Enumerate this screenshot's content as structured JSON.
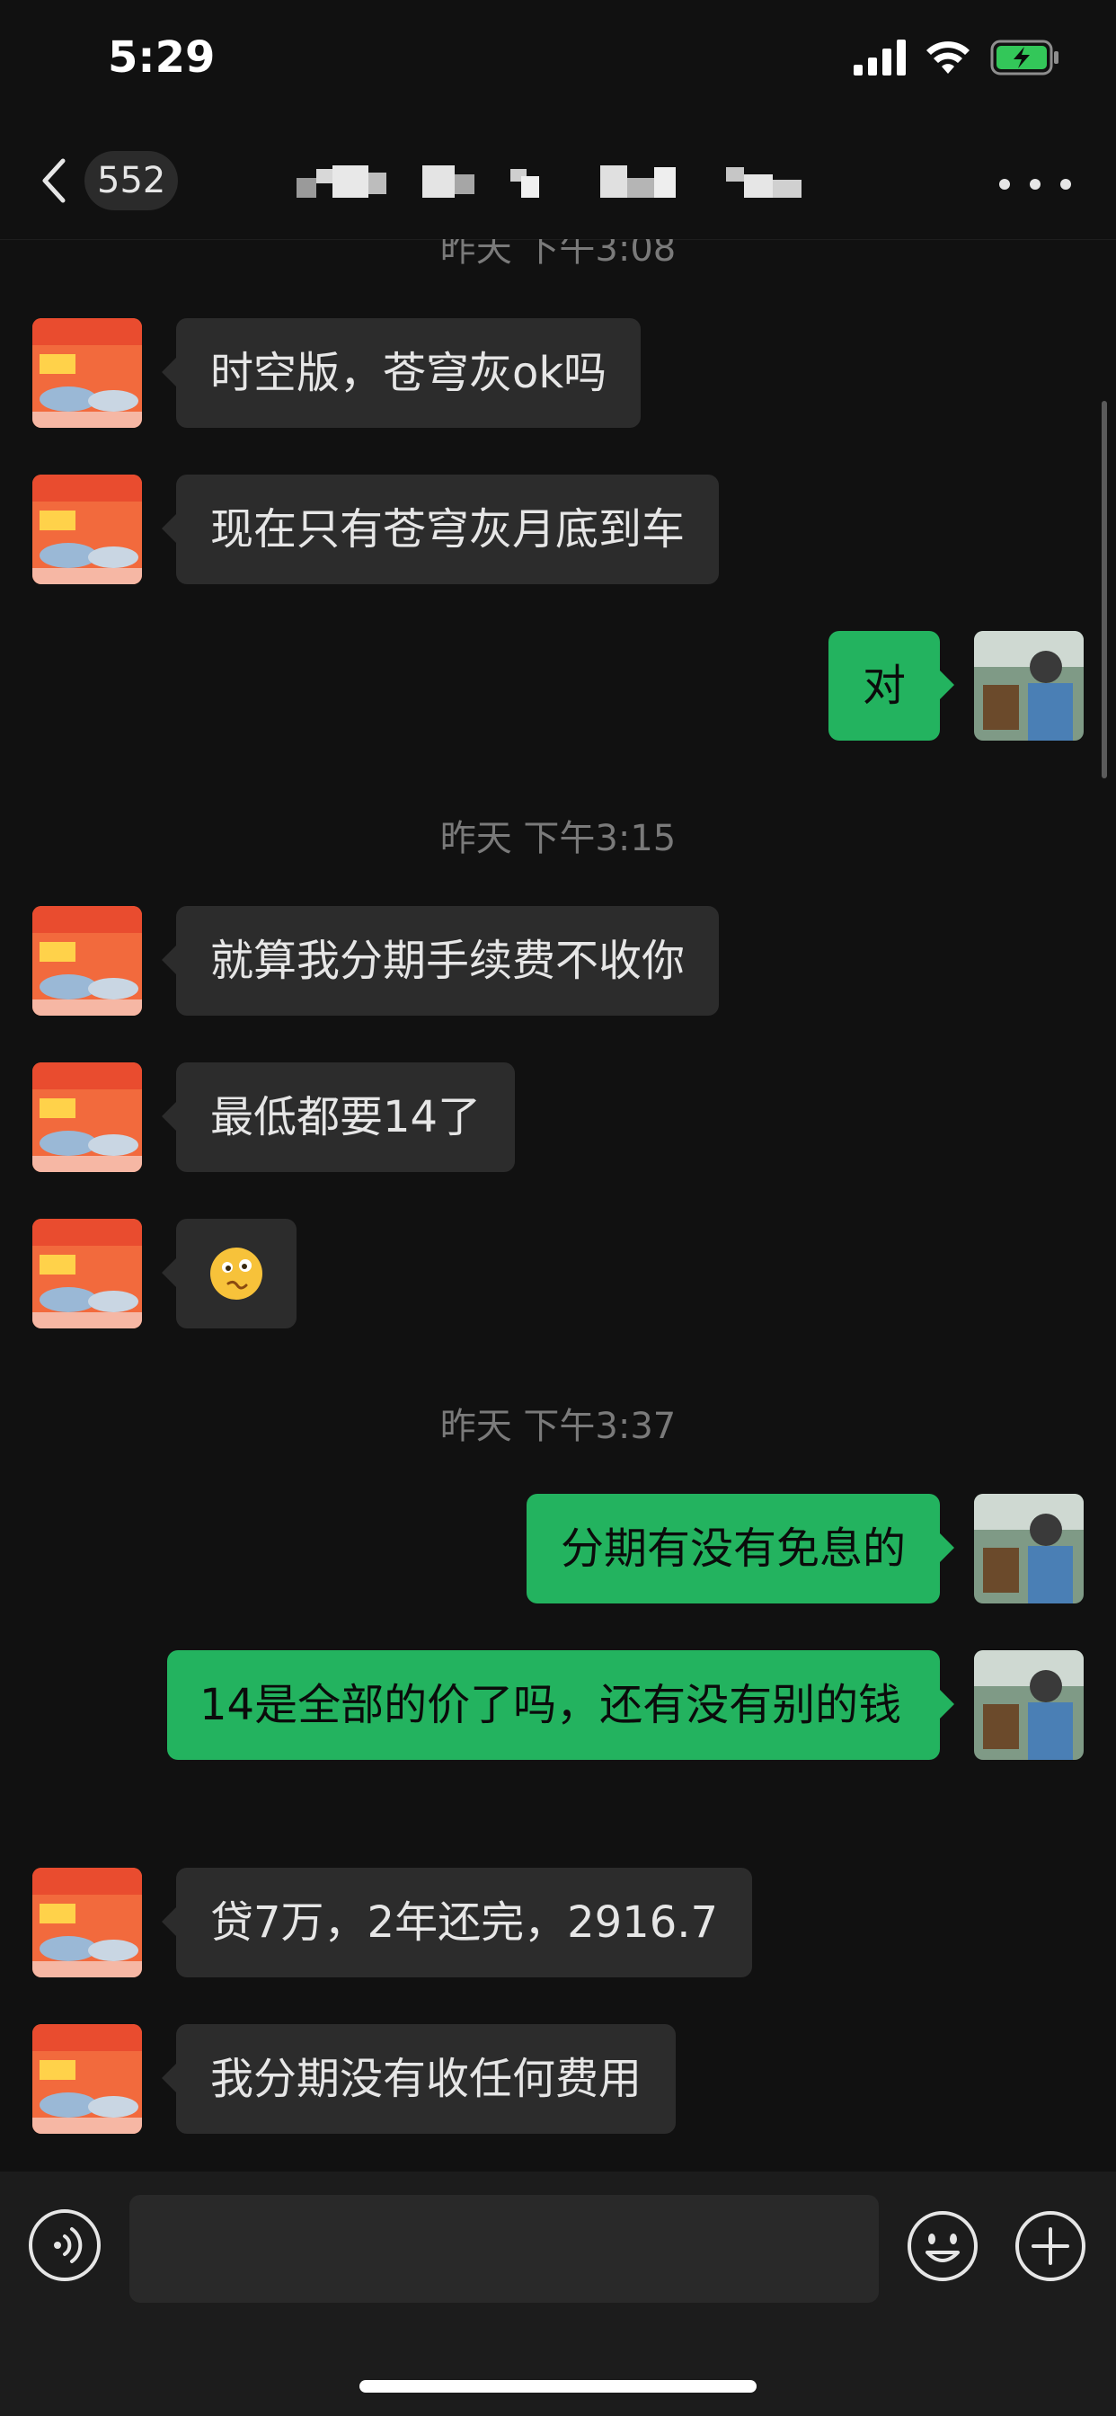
{
  "status_bar": {
    "time": "5:29",
    "icons": [
      "cellular-signal-icon",
      "wifi-icon",
      "battery-charging-icon"
    ],
    "battery_color": "#33c759"
  },
  "navbar": {
    "unread_count": "552",
    "title_obscured": true,
    "icons": [
      "back-arrow-icon",
      "more-options-icon"
    ]
  },
  "chat": {
    "timestamps": [
      "昨天 下午3:08",
      "昨天 下午3:15",
      "昨天 下午3:37"
    ],
    "messages": [
      {
        "side": "in",
        "text": "时空版，苍穹灰ok吗"
      },
      {
        "side": "in",
        "text": "现在只有苍穹灰月底到车"
      },
      {
        "side": "out",
        "text": "对"
      },
      {
        "side": "in",
        "text": "就算我分期手续费不收你"
      },
      {
        "side": "in",
        "text": "最低都要14了"
      },
      {
        "side": "in",
        "type": "emoji",
        "emoji": "woozy-face-emoji"
      },
      {
        "side": "out",
        "text": "分期有没有免息的"
      },
      {
        "side": "out",
        "text": "14是全部的价了吗，还有没有别的钱"
      },
      {
        "side": "in",
        "text": "贷7万，2年还完，2916.7"
      },
      {
        "side": "in",
        "text": "我分期没有收任何费用"
      }
    ],
    "incoming_bubble_color": "#2c2c2c",
    "outgoing_bubble_color": "#23b35f"
  },
  "input_bar": {
    "value": "",
    "icons": [
      "voice-icon",
      "emoji-icon",
      "plus-icon"
    ]
  }
}
